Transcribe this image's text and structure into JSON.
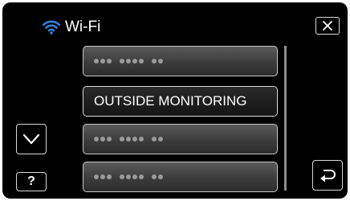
{
  "header": {
    "title": "Wi-Fi",
    "wifi_icon": "wifi-icon",
    "close_icon": "close-icon"
  },
  "list": {
    "items": [
      {
        "label": "",
        "icon": "masked-network-name"
      },
      {
        "label": "OUTSIDE MONITORING",
        "selected": true
      },
      {
        "label": "",
        "icon": "masked-network-name"
      },
      {
        "label": "",
        "icon": "masked-network-name"
      }
    ]
  },
  "controls": {
    "down_icon": "chevron-down-icon",
    "help_label": "?",
    "back_icon": "return-arrow-icon"
  },
  "colors": {
    "background": "#000000",
    "wifi_accent": "#2f7fd8",
    "text": "#ffffff",
    "masked_dots": "#9a9a9a"
  }
}
